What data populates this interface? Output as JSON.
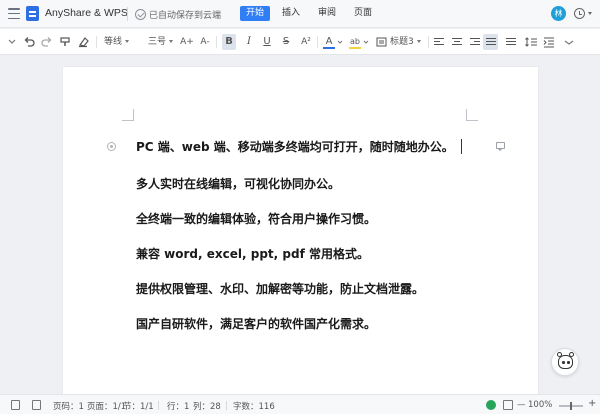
{
  "app": {
    "title": "AnyShare & WPS",
    "save_status": "已自动保存到云端",
    "avatar_letter": "林",
    "menu_tabs": [
      {
        "label": "开始",
        "active": true
      },
      {
        "label": "插入",
        "active": false
      },
      {
        "label": "审阅",
        "active": false
      },
      {
        "label": "页面",
        "active": false
      }
    ]
  },
  "toolbar": {
    "font_family": "等线",
    "font_size": "三号",
    "grow_font": "A+",
    "shrink_font": "A-",
    "bold": "B",
    "italic": "I",
    "underline": "U",
    "strikethrough": "S",
    "superscript": "A²",
    "font_color": "A",
    "highlight": "ab",
    "paragraph_style": "标题3",
    "font_color_hex": "#2f6fe4",
    "highlight_hex": "#f5d33a",
    "accent_hex": "#2f7ef5"
  },
  "document": {
    "paragraphs": [
      "PC 端、web 端、移动端多终端均可打开，随时随地办公。",
      "多人实时在线编辑，可视化协同办公。",
      "全终端一致的编辑体验，符合用户操作习惯。",
      "兼容 word, excel, ppt, pdf 常用格式。",
      "提供权限管理、水印、加解密等功能，防止文档泄露。",
      "国产自研软件，满足客户的软件国产化需求。"
    ]
  },
  "statusbar": {
    "page_number": "页码：1",
    "page_count": "页面：1/1",
    "section": "节：1/1",
    "line": "行：1",
    "column": "列：28",
    "word_count": "字数：116",
    "zoom_out": "—",
    "zoom": "100%",
    "zoom_in": "+",
    "zoom_level": 1.0
  }
}
